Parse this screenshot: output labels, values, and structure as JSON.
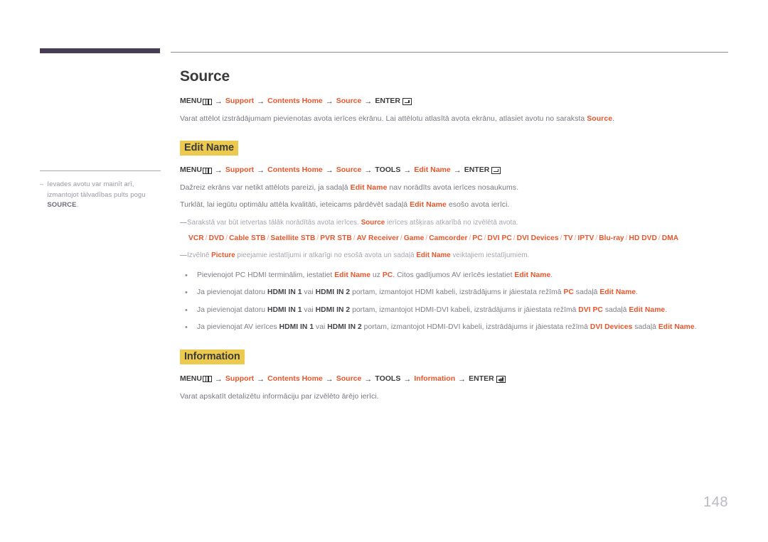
{
  "document": {
    "page_number": "148"
  },
  "sidebar": {
    "note": {
      "dash": "–",
      "text_before": "Ievades avotu var mainīt arī, izmantojot tālvadības pults pogu ",
      "bold": "SOURCE",
      "text_after": "."
    }
  },
  "sections": {
    "source": {
      "title": "Source",
      "path": {
        "menu": "MENU",
        "arrow": "→",
        "steps": [
          "Support",
          "Contents Home",
          "Source"
        ],
        "enter": "ENTER"
      },
      "paragraph": {
        "text_before": "Varat attēlot izstrādājumam pievienotas avota ierīces ekrānu. Lai attēlotu atlasītā avota ekrānu, atlasiet avotu no saraksta ",
        "accent": "Source",
        "text_after": "."
      }
    },
    "edit_name": {
      "heading": "Edit Name",
      "path": {
        "menu": "MENU",
        "arrow": "→",
        "steps": [
          "Support",
          "Contents Home",
          "Source"
        ],
        "tools": "TOOLS",
        "final_step": "Edit Name",
        "enter": "ENTER"
      },
      "paragraphs": [
        {
          "before": "Dažreiz ekrāns var netikt attēlots pareizi, ja sadaļā ",
          "accent": "Edit Name",
          "after": " nav norādīts avota ierīces nosaukums."
        },
        {
          "before": "Turklāt, lai iegūtu optimālu attēla kvalitāti, ieteicams pārdēvēt sadaļā ",
          "accent": "Edit Name",
          "after": " esošo avota ierīci."
        }
      ],
      "notes": [
        {
          "dash": "—",
          "before": "Sarakstā var būt ietvertas tālāk norādītās avota ierīces. ",
          "accent": "Source",
          "after": " ierīces atšķiras atkarībā no izvēlētā avota."
        },
        {
          "dash": "—",
          "before": "Izvēlnē ",
          "accent": "Picture",
          "middle": " pieejamie iestatījumi ir atkarīgi no esošā avota un sadaļā ",
          "accent2": "Edit Name",
          "after": " veiktajiem iestatījumiem."
        }
      ],
      "device_list": {
        "separator": "/",
        "devices": [
          "VCR",
          "DVD",
          "Cable STB",
          "Satellite STB",
          "PVR STB",
          "AV Receiver",
          "Game",
          "Camcorder",
          "PC",
          "DVI PC",
          "DVI Devices",
          "TV",
          "IPTV",
          "Blu-ray",
          "HD DVD",
          "DMA"
        ]
      },
      "bullets": [
        {
          "marker": "•",
          "parts": [
            {
              "t": "Pievienojot PC HDMI terminālim, iestatiet ",
              "s": "plain"
            },
            {
              "t": "Edit Name",
              "s": "accent"
            },
            {
              "t": " uz ",
              "s": "plain"
            },
            {
              "t": "PC",
              "s": "accent"
            },
            {
              "t": ". Citos gadījumos AV ierīcēs iestatiet ",
              "s": "plain"
            },
            {
              "t": "Edit Name",
              "s": "accent"
            },
            {
              "t": ".",
              "s": "plain"
            }
          ]
        },
        {
          "marker": "•",
          "parts": [
            {
              "t": "Ja pievienojat datoru ",
              "s": "plain"
            },
            {
              "t": "HDMI IN 1",
              "s": "dark"
            },
            {
              "t": " vai ",
              "s": "plain"
            },
            {
              "t": "HDMI IN 2",
              "s": "dark"
            },
            {
              "t": " portam, izmantojot HDMI kabeli, izstrādājums ir jāiestata režīmā ",
              "s": "plain"
            },
            {
              "t": "PC",
              "s": "accent"
            },
            {
              "t": " sadaļā ",
              "s": "plain"
            },
            {
              "t": "Edit Name",
              "s": "accent"
            },
            {
              "t": ".",
              "s": "plain"
            }
          ]
        },
        {
          "marker": "•",
          "parts": [
            {
              "t": "Ja pievienojat datoru ",
              "s": "plain"
            },
            {
              "t": "HDMI IN 1",
              "s": "dark"
            },
            {
              "t": " vai ",
              "s": "plain"
            },
            {
              "t": "HDMI IN 2",
              "s": "dark"
            },
            {
              "t": " portam, izmantojot HDMI-DVI kabeli, izstrādājums ir jāiestata režīmā ",
              "s": "plain"
            },
            {
              "t": "DVI PC",
              "s": "accent"
            },
            {
              "t": " sadaļā ",
              "s": "plain"
            },
            {
              "t": "Edit Name",
              "s": "accent"
            },
            {
              "t": ".",
              "s": "plain"
            }
          ]
        },
        {
          "marker": "•",
          "parts": [
            {
              "t": "Ja pievienojat AV ierīces ",
              "s": "plain"
            },
            {
              "t": "HDMI IN 1",
              "s": "dark"
            },
            {
              "t": " vai ",
              "s": "plain"
            },
            {
              "t": "HDMI IN 2",
              "s": "dark"
            },
            {
              "t": " portam, izmantojot HDMI-DVI kabeli, izstrādājums ir jāiestata režīmā ",
              "s": "plain"
            },
            {
              "t": "DVI Devices",
              "s": "accent"
            },
            {
              "t": " sadaļā ",
              "s": "plain"
            },
            {
              "t": "Edit Name",
              "s": "accent"
            },
            {
              "t": ".",
              "s": "plain"
            }
          ]
        }
      ]
    },
    "information": {
      "heading": "Information",
      "path": {
        "menu": "MENU",
        "arrow": "→",
        "steps": [
          "Support",
          "Contents Home",
          "Source"
        ],
        "tools": "TOOLS",
        "final_step": "Information",
        "enter": "ENTER"
      },
      "paragraph": "Varat apskatīt detalizētu informāciju par izvēlēto ārējo ierīci."
    }
  },
  "colors": {
    "accent": "#e8552a",
    "highlight": "#ecc94f",
    "top_bar": "#463d54",
    "page_number": "#b9bac6"
  }
}
